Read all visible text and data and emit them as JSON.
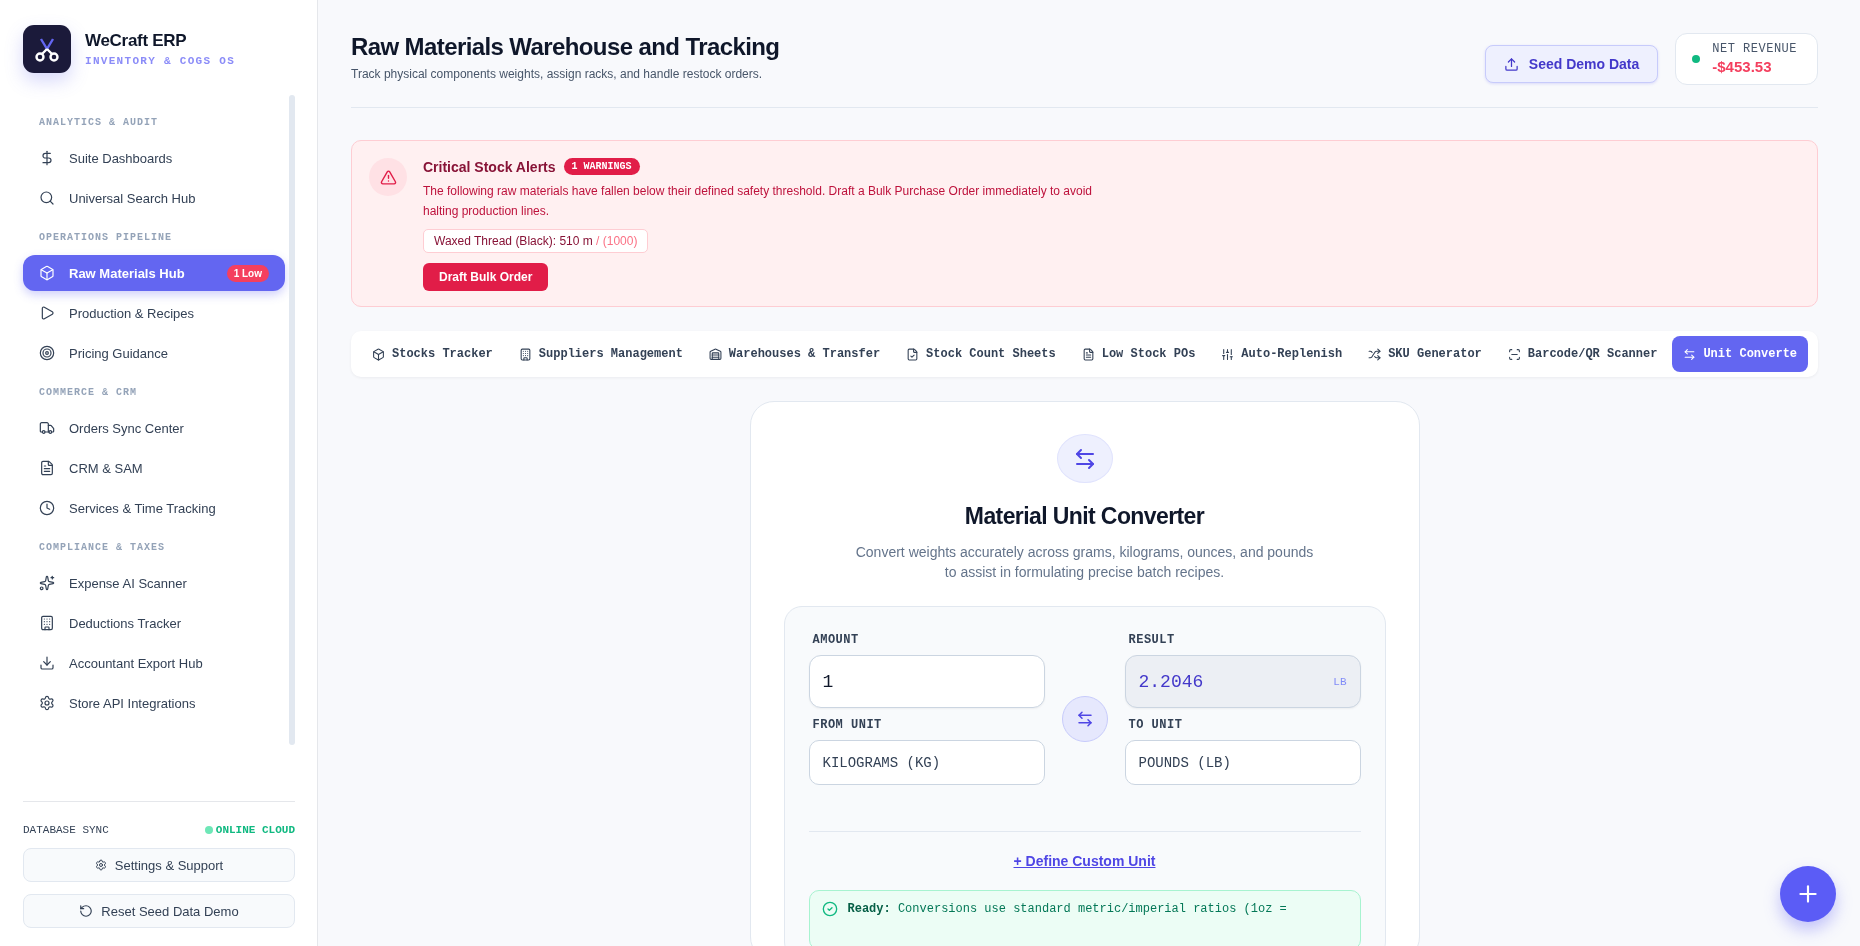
{
  "app": {
    "name": "WeCraft ERP",
    "tagline": "INVENTORY & COGS OS"
  },
  "sidebar": {
    "sections": [
      {
        "title": "ANALYTICS & AUDIT",
        "items": [
          {
            "label": "Suite Dashboards",
            "selected": false
          },
          {
            "label": "Universal Search Hub",
            "selected": false
          }
        ]
      },
      {
        "title": "OPERATIONS PIPELINE",
        "items": [
          {
            "label": "Raw Materials Hub",
            "selected": true,
            "badge": "1 Low"
          },
          {
            "label": "Production & Recipes",
            "selected": false
          },
          {
            "label": "Pricing Guidance",
            "selected": false
          }
        ]
      },
      {
        "title": "COMMERCE & CRM",
        "items": [
          {
            "label": "Orders Sync Center",
            "selected": false
          },
          {
            "label": "CRM & SAM",
            "selected": false
          },
          {
            "label": "Services & Time Tracking",
            "selected": false
          }
        ]
      },
      {
        "title": "COMPLIANCE & TAXES",
        "items": [
          {
            "label": "Expense AI Scanner",
            "selected": false
          },
          {
            "label": "Deductions Tracker",
            "selected": false
          },
          {
            "label": "Accountant Export Hub",
            "selected": false
          },
          {
            "label": "Store API Integrations",
            "selected": false
          }
        ]
      }
    ],
    "sync": {
      "label": "DATABASE SYNC",
      "status": "ONLINE CLOUD"
    },
    "buttons": [
      "Settings & Support",
      "Reset Seed Data Demo"
    ]
  },
  "header": {
    "title": "Raw Materials Warehouse and Tracking",
    "subtitle": "Track physical components weights, assign racks, and handle restock orders.",
    "seed_button": "Seed Demo Data",
    "revenue": {
      "label": "NET REVENUE",
      "value": "-$453.53"
    }
  },
  "alert": {
    "title": "Critical Stock Alerts",
    "badge": "1 WARNINGS",
    "message": "The following raw materials have fallen below their defined safety threshold. Draft a Bulk Purchase Order immediately to avoid halting production lines.",
    "items": [
      {
        "name": "Waxed Thread (Black): 510 m",
        "threshold": "/ (1000)"
      }
    ],
    "button": "Draft Bulk Order"
  },
  "tabs": [
    {
      "label": "Stocks Tracker",
      "selected": false
    },
    {
      "label": "Suppliers Management",
      "selected": false
    },
    {
      "label": "Warehouses & Transfer",
      "selected": false
    },
    {
      "label": "Stock Count Sheets",
      "selected": false
    },
    {
      "label": "Low Stock POs",
      "selected": false
    },
    {
      "label": "Auto-Replenish",
      "selected": false
    },
    {
      "label": "SKU Generator",
      "selected": false
    },
    {
      "label": "Barcode/QR Scanner",
      "selected": false
    },
    {
      "label": "Unit Converte",
      "selected": true
    }
  ],
  "converter": {
    "title": "Material Unit Converter",
    "description": "Convert weights accurately across grams, kilograms, ounces, and pounds to assist in formulating precise batch recipes.",
    "amount": {
      "label": "AMOUNT",
      "value": "1"
    },
    "result": {
      "label": "RESULT",
      "value": "2.2046",
      "unit": "LB"
    },
    "from_unit": {
      "label": "FROM UNIT",
      "value": "KILOGRAMS (KG)"
    },
    "to_unit": {
      "label": "TO UNIT",
      "value": "POUNDS (LB)"
    },
    "link": "+ Define Custom Unit",
    "status": {
      "text": "**Ready:** Conversions use standard metric/imperial ratios (1oz ="
    }
  }
}
